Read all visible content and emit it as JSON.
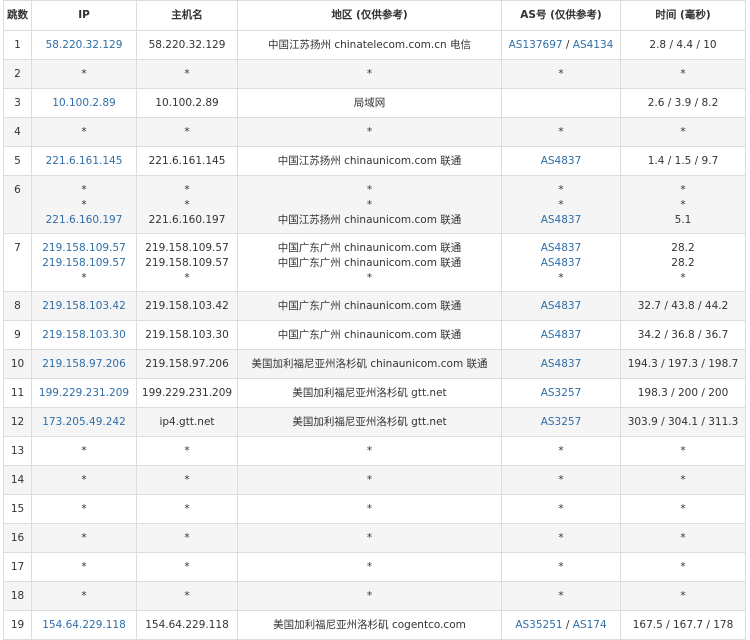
{
  "headers": [
    "跳数",
    "IP",
    "主机名",
    "地区 (仅供参考)",
    "AS号 (仅供参考)",
    "时间 (毫秒)"
  ],
  "rows": [
    {
      "hop": "1",
      "ip": [
        "58.220.32.129"
      ],
      "host": [
        "58.220.32.129"
      ],
      "region": [
        "中国江苏扬州 chinatelecom.com.cn 电信"
      ],
      "as": [
        [
          "AS137697",
          "AS4134"
        ]
      ],
      "time": [
        "2.8 / 4.4 / 10"
      ]
    },
    {
      "hop": "2",
      "ip": [
        "*"
      ],
      "host": [
        "*"
      ],
      "region": [
        "*"
      ],
      "as": [
        [
          "*"
        ]
      ],
      "time": [
        "*"
      ]
    },
    {
      "hop": "3",
      "ip": [
        "10.100.2.89"
      ],
      "host": [
        "10.100.2.89"
      ],
      "region": [
        "局域网"
      ],
      "as": [
        []
      ],
      "time": [
        "2.6 / 3.9 / 8.2"
      ]
    },
    {
      "hop": "4",
      "ip": [
        "*"
      ],
      "host": [
        "*"
      ],
      "region": [
        "*"
      ],
      "as": [
        [
          "*"
        ]
      ],
      "time": [
        "*"
      ]
    },
    {
      "hop": "5",
      "ip": [
        "221.6.161.145"
      ],
      "host": [
        "221.6.161.145"
      ],
      "region": [
        "中国江苏扬州 chinaunicom.com 联通"
      ],
      "as": [
        [
          "AS4837"
        ]
      ],
      "time": [
        "1.4 / 1.5 / 9.7"
      ]
    },
    {
      "hop": "6",
      "ip": [
        "*",
        "*",
        "221.6.160.197"
      ],
      "host": [
        "*",
        "*",
        "221.6.160.197"
      ],
      "region": [
        "*",
        "*",
        "中国江苏扬州 chinaunicom.com 联通"
      ],
      "as": [
        [
          "*"
        ],
        [
          "*"
        ],
        [
          "AS4837"
        ]
      ],
      "time": [
        "*",
        "*",
        "5.1"
      ]
    },
    {
      "hop": "7",
      "ip": [
        "219.158.109.57",
        "219.158.109.57",
        "*"
      ],
      "host": [
        "219.158.109.57",
        "219.158.109.57",
        "*"
      ],
      "region": [
        "中国广东广州 chinaunicom.com 联通",
        "中国广东广州 chinaunicom.com 联通",
        "*"
      ],
      "as": [
        [
          "AS4837"
        ],
        [
          "AS4837"
        ],
        [
          "*"
        ]
      ],
      "time": [
        "28.2",
        "28.2",
        "*"
      ]
    },
    {
      "hop": "8",
      "ip": [
        "219.158.103.42"
      ],
      "host": [
        "219.158.103.42"
      ],
      "region": [
        "中国广东广州 chinaunicom.com 联通"
      ],
      "as": [
        [
          "AS4837"
        ]
      ],
      "time": [
        "32.7 / 43.8 / 44.2"
      ]
    },
    {
      "hop": "9",
      "ip": [
        "219.158.103.30"
      ],
      "host": [
        "219.158.103.30"
      ],
      "region": [
        "中国广东广州 chinaunicom.com 联通"
      ],
      "as": [
        [
          "AS4837"
        ]
      ],
      "time": [
        "34.2 / 36.8 / 36.7"
      ]
    },
    {
      "hop": "10",
      "ip": [
        "219.158.97.206"
      ],
      "host": [
        "219.158.97.206"
      ],
      "region": [
        "美国加利福尼亚州洛杉矶 chinaunicom.com 联通"
      ],
      "as": [
        [
          "AS4837"
        ]
      ],
      "time": [
        "194.3 / 197.3 / 198.7"
      ]
    },
    {
      "hop": "11",
      "ip": [
        "199.229.231.209"
      ],
      "host": [
        "199.229.231.209"
      ],
      "region": [
        "美国加利福尼亚州洛杉矶 gtt.net"
      ],
      "as": [
        [
          "AS3257"
        ]
      ],
      "time": [
        "198.3 / 200 / 200"
      ]
    },
    {
      "hop": "12",
      "ip": [
        "173.205.49.242"
      ],
      "host": [
        "ip4.gtt.net"
      ],
      "region": [
        "美国加利福尼亚州洛杉矶 gtt.net"
      ],
      "as": [
        [
          "AS3257"
        ]
      ],
      "time": [
        "303.9 / 304.1 / 311.3"
      ]
    },
    {
      "hop": "13",
      "ip": [
        "*"
      ],
      "host": [
        "*"
      ],
      "region": [
        "*"
      ],
      "as": [
        [
          "*"
        ]
      ],
      "time": [
        "*"
      ]
    },
    {
      "hop": "14",
      "ip": [
        "*"
      ],
      "host": [
        "*"
      ],
      "region": [
        "*"
      ],
      "as": [
        [
          "*"
        ]
      ],
      "time": [
        "*"
      ]
    },
    {
      "hop": "15",
      "ip": [
        "*"
      ],
      "host": [
        "*"
      ],
      "region": [
        "*"
      ],
      "as": [
        [
          "*"
        ]
      ],
      "time": [
        "*"
      ]
    },
    {
      "hop": "16",
      "ip": [
        "*"
      ],
      "host": [
        "*"
      ],
      "region": [
        "*"
      ],
      "as": [
        [
          "*"
        ]
      ],
      "time": [
        "*"
      ]
    },
    {
      "hop": "17",
      "ip": [
        "*"
      ],
      "host": [
        "*"
      ],
      "region": [
        "*"
      ],
      "as": [
        [
          "*"
        ]
      ],
      "time": [
        "*"
      ]
    },
    {
      "hop": "18",
      "ip": [
        "*"
      ],
      "host": [
        "*"
      ],
      "region": [
        "*"
      ],
      "as": [
        [
          "*"
        ]
      ],
      "time": [
        "*"
      ]
    },
    {
      "hop": "19",
      "ip": [
        "154.64.229.118"
      ],
      "host": [
        "154.64.229.118"
      ],
      "region": [
        "美国加利福尼亚州洛杉矶 cogentco.com"
      ],
      "as": [
        [
          "AS35251",
          "AS174"
        ]
      ],
      "time": [
        "167.5 / 167.7 / 178"
      ]
    }
  ],
  "colors": {
    "link": "#2f6ea8",
    "zebra": "#f5f5f5",
    "border": "#dddddd",
    "text": "#333333"
  }
}
